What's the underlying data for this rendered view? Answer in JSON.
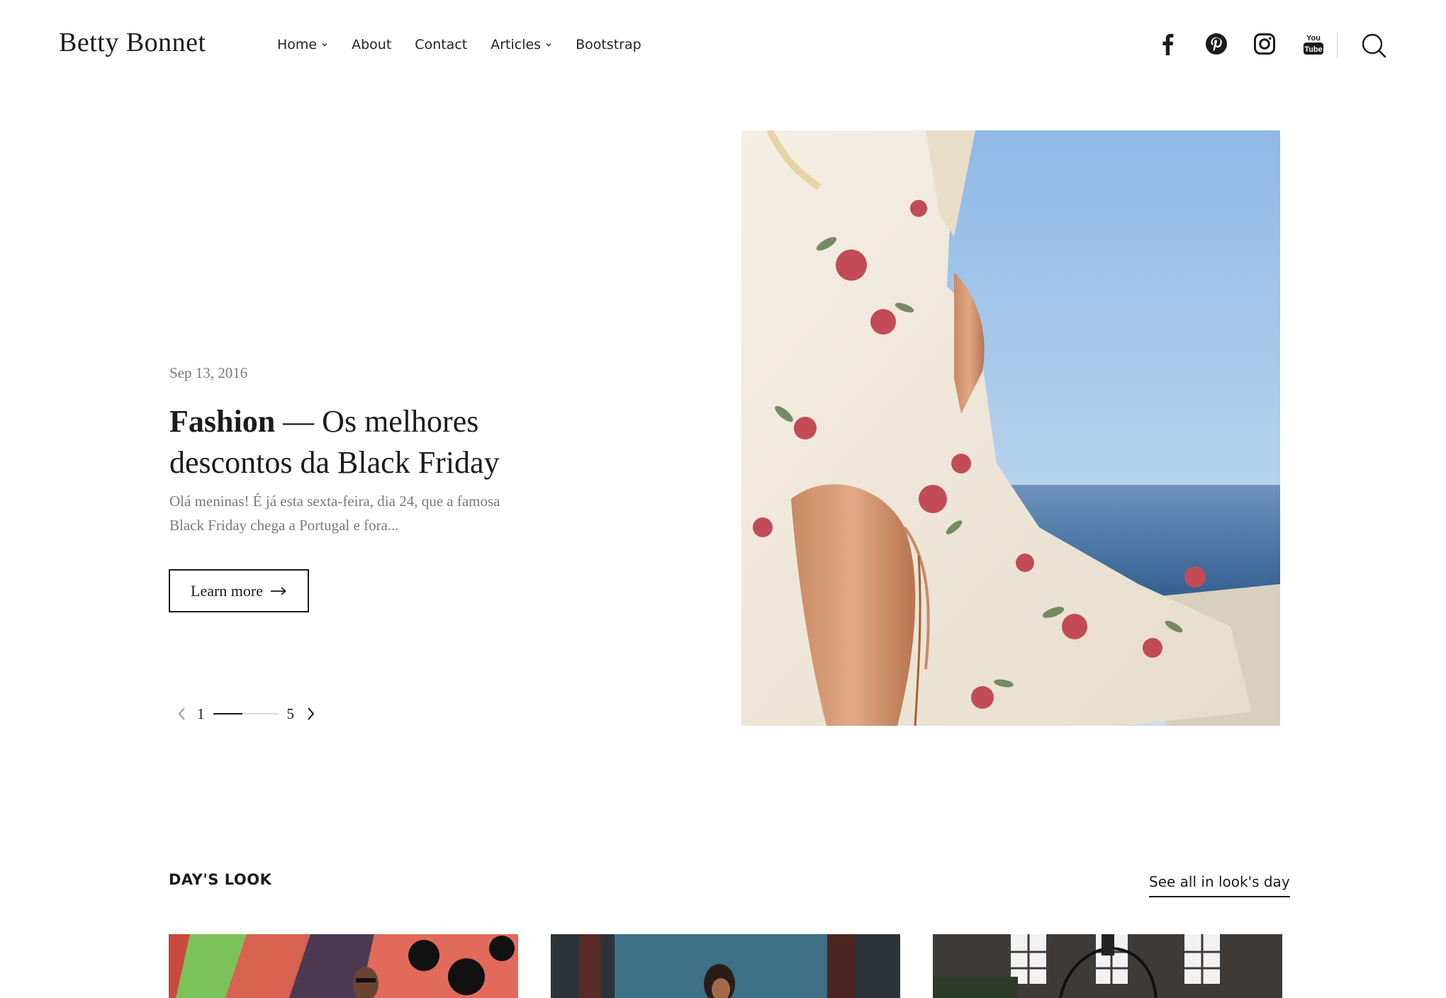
{
  "header": {
    "site_title": "Betty Bonnet",
    "nav": [
      {
        "label": "Home"
      },
      {
        "label": "About"
      },
      {
        "label": "Contact"
      },
      {
        "label": "Articles"
      },
      {
        "label": "Bootstrap"
      }
    ],
    "social_icons": [
      "facebook-icon",
      "pinterest-icon",
      "instagram-icon",
      "youtube-icon"
    ],
    "search_icon": "search-icon"
  },
  "hero": {
    "date": "Sep 13, 2016",
    "title_bold": "Fashion",
    "title_rest": " — Os melhores descontos da Black Friday",
    "excerpt": "Olá meninas! É já esta sexta-feira, dia 24, que a famosa Black Friday chega a Portugal e fora...",
    "button_label": "Learn more",
    "pager": {
      "current": "1",
      "total": "5",
      "progress": 0.45
    }
  },
  "days_look": {
    "title": "DAY'S LOOK",
    "see_all_label": "See all in look's day",
    "cards": [
      {
        "name": "look-card-graffiti"
      },
      {
        "name": "look-card-doorway"
      },
      {
        "name": "look-card-brick-house"
      }
    ]
  },
  "colors": {
    "text": "#1b1b1b",
    "muted": "#7a7a7a",
    "background": "#ffffff"
  }
}
